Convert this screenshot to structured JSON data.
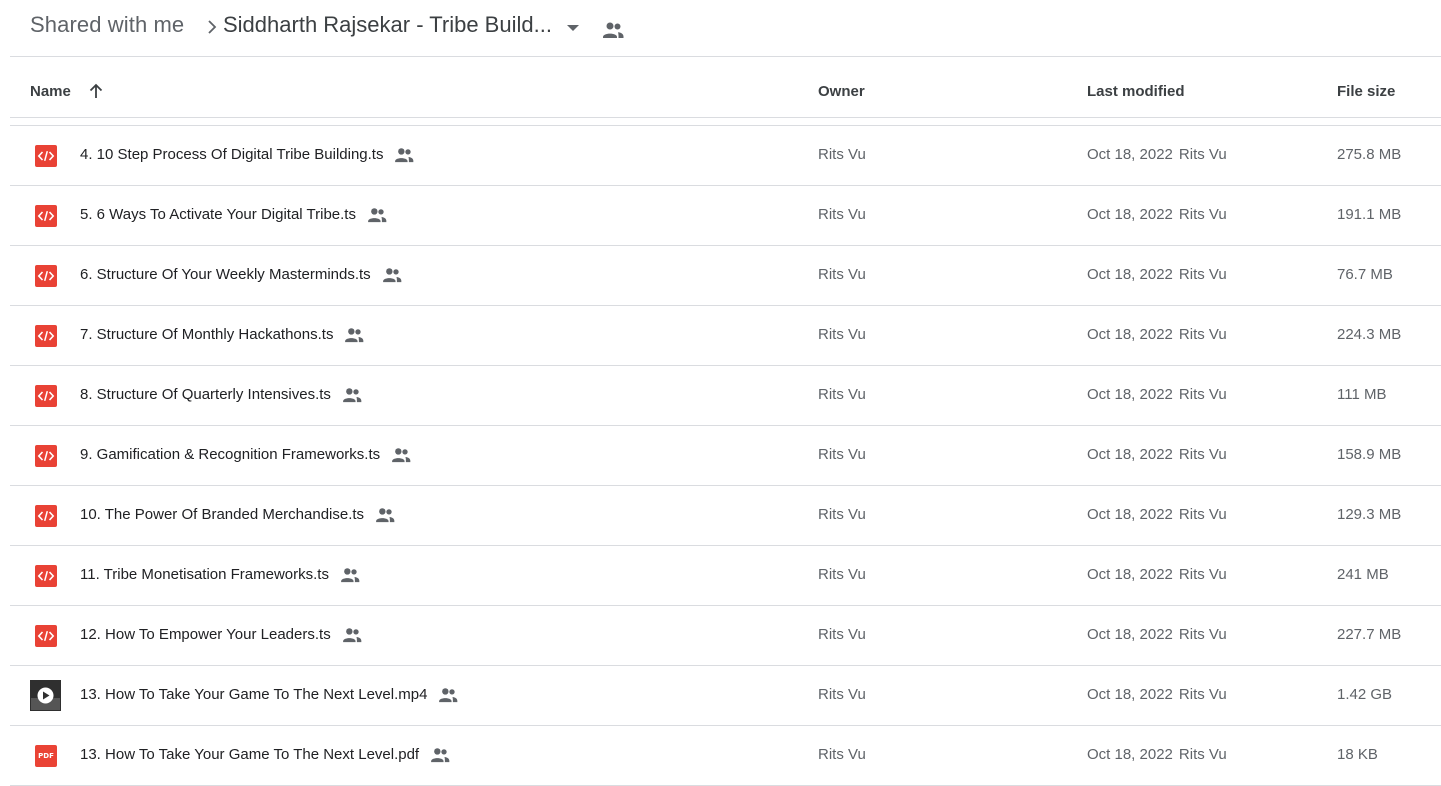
{
  "breadcrumb": {
    "root": "Shared with me",
    "current": "Siddharth Rajsekar - Tribe Build..."
  },
  "columns": {
    "name": "Name",
    "owner": "Owner",
    "last_modified": "Last modified",
    "file_size": "File size"
  },
  "files": [
    {
      "name": "4. 10 Step Process Of Digital Tribe Building.ts",
      "owner": "Rits Vu",
      "date": "Oct 18, 2022",
      "modified_by": "Rits Vu",
      "size": "275.8 MB",
      "type": "code"
    },
    {
      "name": "5. 6 Ways To Activate Your Digital Tribe.ts",
      "owner": "Rits Vu",
      "date": "Oct 18, 2022",
      "modified_by": "Rits Vu",
      "size": "191.1 MB",
      "type": "code"
    },
    {
      "name": "6. Structure Of Your Weekly Masterminds.ts",
      "owner": "Rits Vu",
      "date": "Oct 18, 2022",
      "modified_by": "Rits Vu",
      "size": "76.7 MB",
      "type": "code"
    },
    {
      "name": "7. Structure Of Monthly Hackathons.ts",
      "owner": "Rits Vu",
      "date": "Oct 18, 2022",
      "modified_by": "Rits Vu",
      "size": "224.3 MB",
      "type": "code"
    },
    {
      "name": "8. Structure Of Quarterly Intensives.ts",
      "owner": "Rits Vu",
      "date": "Oct 18, 2022",
      "modified_by": "Rits Vu",
      "size": "111 MB",
      "type": "code"
    },
    {
      "name": "9. Gamification & Recognition Frameworks.ts",
      "owner": "Rits Vu",
      "date": "Oct 18, 2022",
      "modified_by": "Rits Vu",
      "size": "158.9 MB",
      "type": "code"
    },
    {
      "name": "10. The Power Of Branded Merchandise.ts",
      "owner": "Rits Vu",
      "date": "Oct 18, 2022",
      "modified_by": "Rits Vu",
      "size": "129.3 MB",
      "type": "code"
    },
    {
      "name": "11. Tribe Monetisation Frameworks.ts",
      "owner": "Rits Vu",
      "date": "Oct 18, 2022",
      "modified_by": "Rits Vu",
      "size": "241 MB",
      "type": "code"
    },
    {
      "name": "12. How To Empower Your Leaders.ts",
      "owner": "Rits Vu",
      "date": "Oct 18, 2022",
      "modified_by": "Rits Vu",
      "size": "227.7 MB",
      "type": "code"
    },
    {
      "name": "13. How To Take Your Game To The Next Level.mp4",
      "owner": "Rits Vu",
      "date": "Oct 18, 2022",
      "modified_by": "Rits Vu",
      "size": "1.42 GB",
      "type": "video"
    },
    {
      "name": "13. How To Take Your Game To The Next Level.pdf",
      "owner": "Rits Vu",
      "date": "Oct 18, 2022",
      "modified_by": "Rits Vu",
      "size": "18 KB",
      "type": "pdf",
      "icon_text": "PDF"
    }
  ],
  "colors": {
    "code_icon": "#e94235",
    "pdf_icon": "#ea4335",
    "divider": "#dadce0",
    "secondary_text": "#5f6368"
  }
}
